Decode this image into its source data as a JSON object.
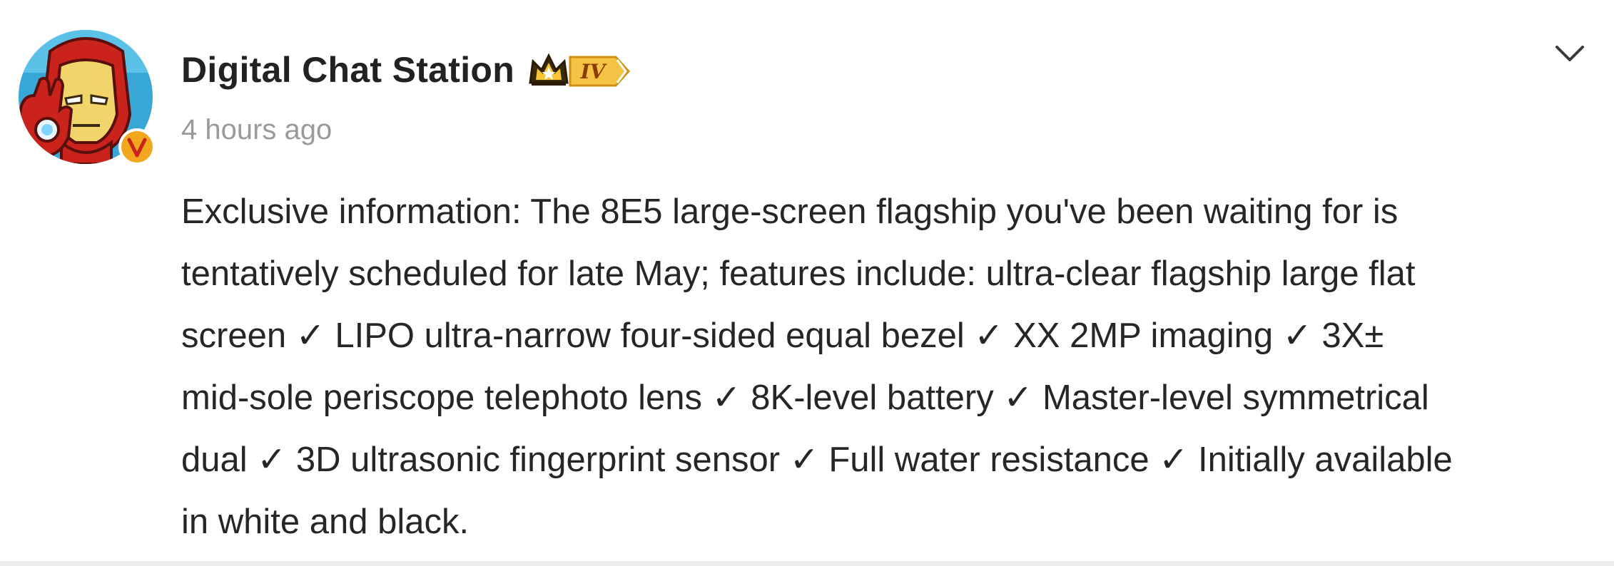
{
  "post": {
    "author": {
      "name": "Digital Chat Station",
      "level_badge": "IV",
      "avatar_icon": "iron-man-avatar",
      "verified_icon": "verified-v-badge",
      "verified_label": "V"
    },
    "timestamp": "4 hours ago",
    "menu_icon": "chevron-down-icon",
    "content_lines": [
      "Exclusive information: The 8E5 large-screen flagship you've been waiting for is",
      "tentatively scheduled for late May; features include: ultra-clear flagship large flat",
      "screen ✓ LIPO ultra-narrow four-sided equal bezel ✓ XX 2MP imaging ✓ 3X±",
      "mid-sole periscope telephoto lens ✓ 8K-level battery ✓ Master-level symmetrical",
      "dual ✓ 3D ultrasonic fingerprint sensor ✓ Full water resistance ✓ Initially available",
      "in white and black."
    ]
  },
  "colors": {
    "username": "#222222",
    "timestamp": "#9a9a9a",
    "body_text": "#262626",
    "verified_badge": "#f3a71f",
    "crown_badge": "#e8a41c",
    "divider": "#ececec"
  }
}
